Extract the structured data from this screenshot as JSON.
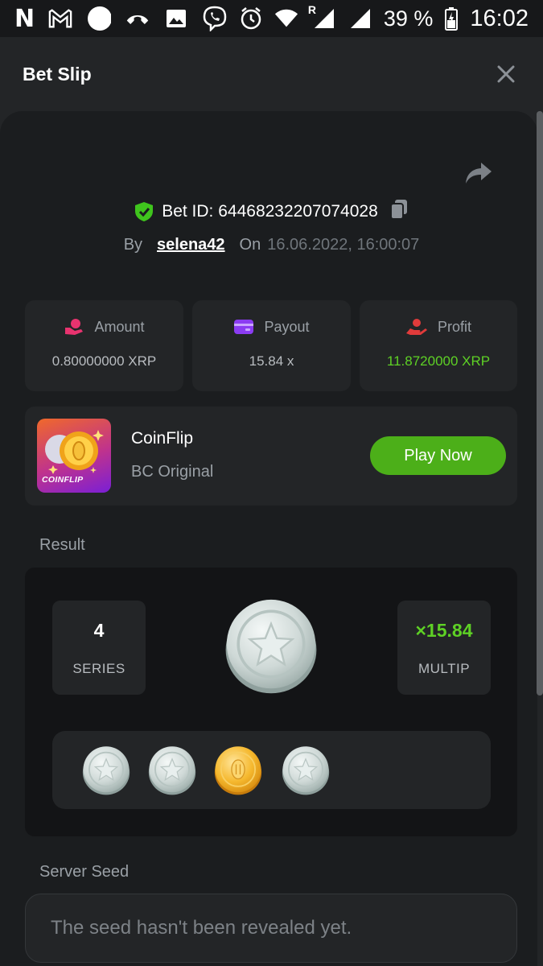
{
  "status_bar": {
    "left_icons": [
      "netflix-icon",
      "gmail-icon",
      "circle-icon",
      "missed-call-icon",
      "gallery-icon",
      "viber-icon"
    ],
    "app_letter": "N",
    "right_icons": [
      "alarm-icon",
      "wifi-icon",
      "signal-roaming-icon",
      "signal-icon",
      "battery-icon"
    ],
    "roaming": "R",
    "battery": "39 %",
    "time": "16:02"
  },
  "header": {
    "title": "Bet Slip"
  },
  "bet": {
    "id_label": "Bet ID: 64468232207074028",
    "by_label": "By",
    "user": "selena42",
    "on_label": "On",
    "date": "16.06.2022, 16:00:07"
  },
  "stats": {
    "amount_label": "Amount",
    "amount_value": "0.80000000 XRP",
    "payout_label": "Payout",
    "payout_value": "15.84 x",
    "profit_label": "Profit",
    "profit_value": "11.8720000 XRP"
  },
  "game": {
    "thumb_text": "COINFLIP",
    "name": "CoinFlip",
    "subtitle": "BC Original",
    "play_label": "Play Now"
  },
  "result": {
    "label": "Result",
    "series_value": "4",
    "series_label": "SERIES",
    "multiplier_value": "×15.84",
    "multiplier_label": "MULTIP",
    "main_coin": "silver-star",
    "coins": [
      "silver-star",
      "silver-star",
      "gold-bitcoin",
      "silver-star"
    ]
  },
  "server_seed": {
    "label": "Server Seed",
    "message": "The seed hasn't been revealed yet."
  },
  "colors": {
    "accent_green": "#4caf19",
    "profit_green": "#5ed125",
    "panel_bg": "#1b1d1f",
    "card_bg": "#232527"
  }
}
